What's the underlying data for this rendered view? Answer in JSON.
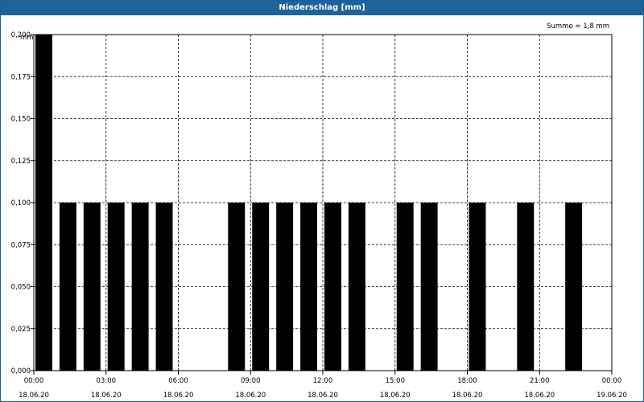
{
  "window": {
    "title": "Niederschlag [mm]"
  },
  "chart_data": {
    "type": "bar",
    "title": "Niederschlag [mm]",
    "ylabel": "mm",
    "annotation": "Summe = 1,8 mm",
    "ylim": [
      0,
      0.2
    ],
    "yticks": [
      "0,000",
      "0,025",
      "0,050",
      "0,075",
      "0,100",
      "0,125",
      "0,150",
      "0,175",
      "0,200"
    ],
    "xticks": [
      {
        "time": "00:00",
        "date": "18.06.20"
      },
      {
        "time": "03:00",
        "date": "18.06.20"
      },
      {
        "time": "06:00",
        "date": "18.06.20"
      },
      {
        "time": "09:00",
        "date": "18.06.20"
      },
      {
        "time": "12:00",
        "date": "18.06.20"
      },
      {
        "time": "15:00",
        "date": "18.06.20"
      },
      {
        "time": "18:00",
        "date": "18.06.20"
      },
      {
        "time": "21:00",
        "date": "18.06.20"
      },
      {
        "time": "00:00",
        "date": "19.06.20"
      }
    ],
    "x": [
      "00:00",
      "01:00",
      "02:00",
      "03:00",
      "04:00",
      "05:00",
      "06:00",
      "07:00",
      "08:00",
      "09:00",
      "10:00",
      "11:00",
      "12:00",
      "13:00",
      "14:00",
      "15:00",
      "16:00",
      "17:00",
      "18:00",
      "19:00",
      "20:00",
      "21:00",
      "22:00",
      "23:00"
    ],
    "values": [
      0.2,
      0.1,
      0.1,
      0.1,
      0.1,
      0.1,
      0,
      0,
      0.1,
      0.1,
      0.1,
      0.1,
      0.1,
      0.1,
      0,
      0.1,
      0.1,
      0,
      0.1,
      0,
      0.1,
      0,
      0.1,
      0
    ],
    "grid": true,
    "colors": {
      "bar": "#000000",
      "titlebar": "#1f639b"
    }
  }
}
